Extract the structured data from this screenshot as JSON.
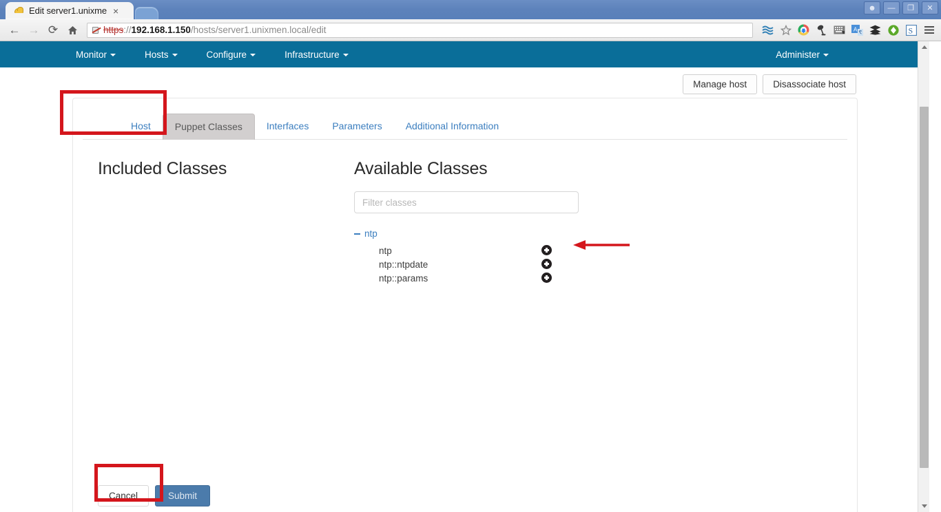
{
  "browser": {
    "tab": {
      "title": "Edit server1.unixme",
      "favicon": "hardhat-icon",
      "close": "×"
    },
    "window_controls": [
      {
        "name": "user-profile-button",
        "glyph": "☻"
      },
      {
        "name": "minimize-button",
        "glyph": "—"
      },
      {
        "name": "maximize-button",
        "glyph": "❐"
      },
      {
        "name": "close-button",
        "glyph": "✕"
      }
    ],
    "nav": {
      "back": "←",
      "forward": "→",
      "reload": "⟳",
      "home": "⌂"
    },
    "omnibox": {
      "scheme": "https",
      "separator": "://",
      "host": "192.168.1.150",
      "path": "/hosts/server1.unixmen.local/edit",
      "full_url": "https://192.168.1.150/hosts/server1.unixmen.local/edit",
      "security": "insecure-https-icon"
    },
    "toolbar_icons": [
      {
        "name": "bookmark-manager-icon",
        "glyph": "≈"
      },
      {
        "name": "bookmark-star-icon",
        "glyph": "☆"
      },
      {
        "name": "chrome-download-extension-icon",
        "glyph": "⬇"
      },
      {
        "name": "lamp-extension-icon",
        "glyph": "⚒"
      },
      {
        "name": "keyboard-extension-icon",
        "glyph": "⌨"
      },
      {
        "name": "translate-extension-icon",
        "glyph": "A"
      },
      {
        "name": "buffer-extension-icon",
        "glyph": "≡"
      },
      {
        "name": "evernote-extension-icon",
        "glyph": "◆"
      },
      {
        "name": "s-extension-icon",
        "glyph": "S"
      },
      {
        "name": "chrome-menu-icon",
        "glyph": "≡"
      }
    ]
  },
  "navbar": {
    "items": [
      {
        "label": "Monitor",
        "has_caret": true
      },
      {
        "label": "Hosts",
        "has_caret": true
      },
      {
        "label": "Configure",
        "has_caret": true
      },
      {
        "label": "Infrastructure",
        "has_caret": true
      }
    ],
    "right": {
      "label": "Administer",
      "has_caret": true
    }
  },
  "actions": {
    "manage_host": "Manage host",
    "disassociate_host": "Disassociate host"
  },
  "tabs": [
    {
      "label": "Host",
      "active": false
    },
    {
      "label": "Puppet Classes",
      "active": true
    },
    {
      "label": "Interfaces",
      "active": false
    },
    {
      "label": "Parameters",
      "active": false
    },
    {
      "label": "Additional Information",
      "active": false
    }
  ],
  "included": {
    "heading": "Included Classes",
    "items": []
  },
  "available": {
    "heading": "Available Classes",
    "filter_placeholder": "Filter classes",
    "filter_value": "",
    "group": {
      "name": "ntp",
      "expanded": true,
      "toggle": "minus-icon",
      "classes": [
        {
          "name": "ntp",
          "add": "add-circle-icon"
        },
        {
          "name": "ntp::ntpdate",
          "add": "add-circle-icon"
        },
        {
          "name": "ntp::params",
          "add": "add-circle-icon"
        }
      ]
    }
  },
  "form": {
    "cancel": "Cancel",
    "submit": "Submit"
  },
  "annotations": {
    "highlight_color": "#d4161c",
    "boxes": [
      {
        "name": "puppet-classes-tab-highlight"
      },
      {
        "name": "submit-button-highlight"
      }
    ],
    "arrow": {
      "name": "add-ntp-class-arrow",
      "points_to": "ntp add-circle-icon"
    }
  },
  "theme": {
    "navbar_color": "#0a6e99",
    "link_color": "#3b7ebf",
    "submit_color": "#4b7bab",
    "annotation_color": "#d4161c"
  }
}
